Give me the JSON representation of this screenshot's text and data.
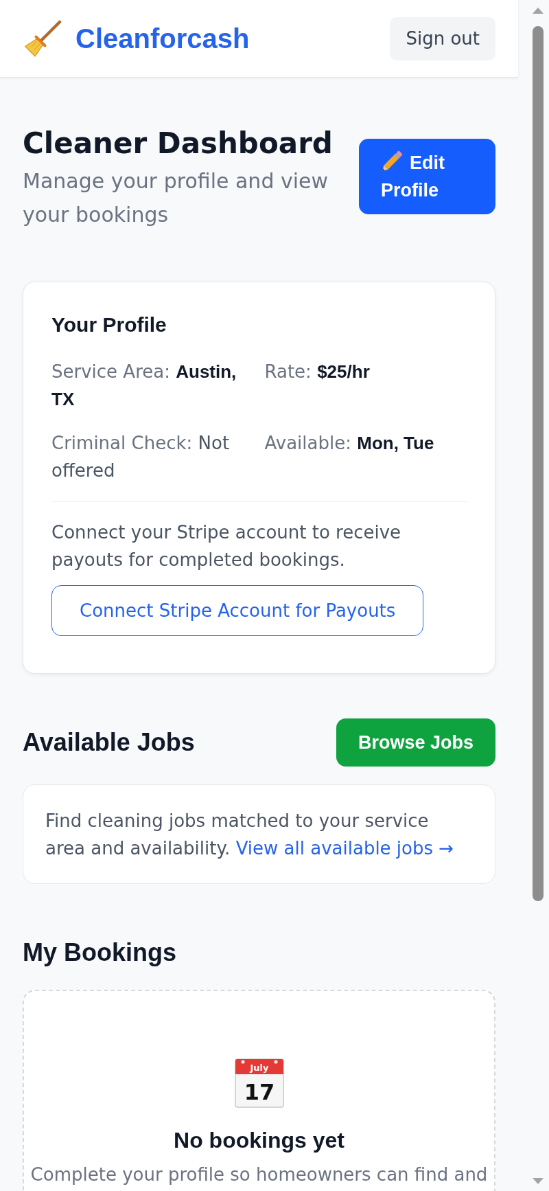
{
  "header": {
    "brand": "Cleanforcash",
    "sign_out": "Sign out"
  },
  "page_header": {
    "title": "Cleaner Dashboard",
    "subtitle": "Manage your profile and view your bookings",
    "edit_button": "Edit Profile"
  },
  "profile": {
    "title": "Your Profile",
    "fields": [
      {
        "label": "Service Area:",
        "value": "Austin, TX",
        "kind": "strong"
      },
      {
        "label": "Rate:",
        "value": "$25/hr",
        "kind": "strong"
      },
      {
        "label": "Criminal Check:",
        "value": "Not offered",
        "kind": "plain"
      },
      {
        "label": "Available:",
        "value": "Mon, Tue",
        "kind": "strong"
      }
    ],
    "stripe_note": "Connect your Stripe account to receive payouts for completed bookings.",
    "stripe_button": "Connect Stripe Account for Payouts"
  },
  "available_jobs": {
    "title": "Available Jobs",
    "button": "Browse Jobs",
    "description": "Find cleaning jobs matched to your service area and availability.",
    "link": "View all available jobs →"
  },
  "bookings": {
    "title": "My Bookings",
    "empty_state": {
      "calendar_month": "July",
      "calendar_day": "17",
      "title": "No bookings yet",
      "text": "Complete your profile so homeowners can find and"
    }
  }
}
